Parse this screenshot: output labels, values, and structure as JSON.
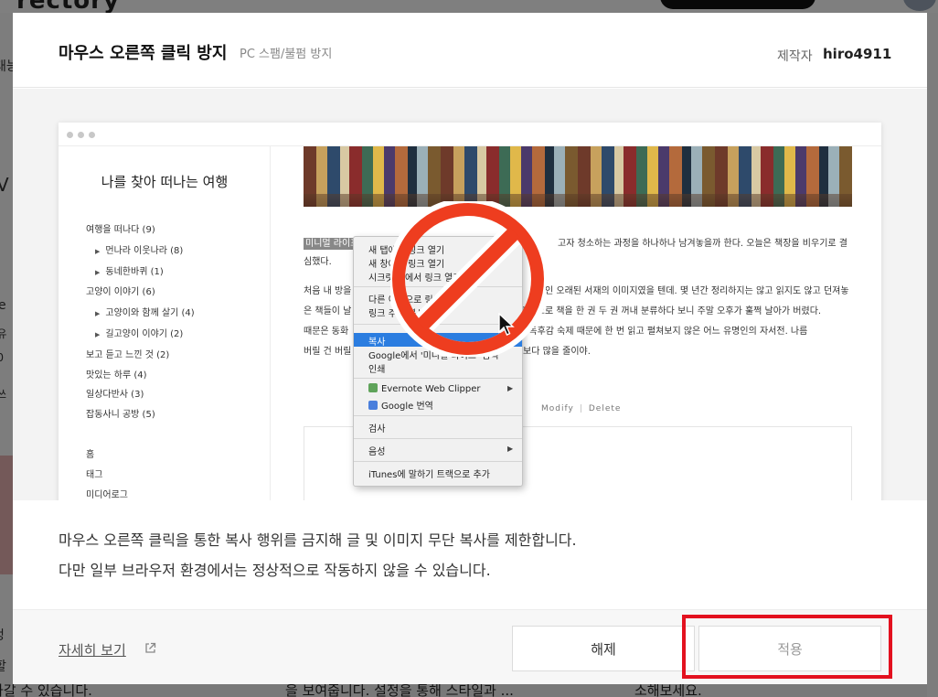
{
  "background": {
    "left_fragments": [
      "태능",
      "V",
      "e",
      "-유",
      "-0",
      "쓰",
      "엉 ",
      "할",
      "가갈 수 있습니다."
    ],
    "bottom_fragments": [
      "을 보여줍니다. 설정을 통해 스타일과 ...",
      "소해보세요."
    ]
  },
  "header": {
    "title": "마우스 오른쪽 클릭 방지",
    "subtitle": "PC 스팸/불펌 방지",
    "author_label": "제작자",
    "author_name": "hiro4911"
  },
  "preview": {
    "blog_title": "나를 찾아 떠나는 여행",
    "categories": [
      {
        "label": "여행을 떠나다 (9)",
        "sub": false
      },
      {
        "label": "먼나라 이웃나라 (8)",
        "sub": true
      },
      {
        "label": "동네한바퀴 (1)",
        "sub": true
      },
      {
        "label": "고양이 이야기 (6)",
        "sub": false
      },
      {
        "label": "고양이와 함께 살기 (4)",
        "sub": true
      },
      {
        "label": "길고양이 이야기 (2)",
        "sub": true
      },
      {
        "label": "보고 듣고 느낀 것 (2)",
        "sub": false
      },
      {
        "label": "맛있는 하루 (4)",
        "sub": false
      },
      {
        "label": "일상다반사 (3)",
        "sub": false
      },
      {
        "label": "잡동사니 공방 (5)",
        "sub": false
      }
    ],
    "nav": [
      "홈",
      "태그",
      "미디어로그"
    ],
    "post": {
      "highlight": "미니멀 라이프",
      "line1": "고자 청소하는 과정을 하나하나 남겨놓을까 한다. 오늘은 책장을 비우기로 결",
      "line2": "심했다.",
      "line3a": "처음 내 방을",
      "line3b": "인 오래된 서재의 이미지였을 텐데. 몇 년간 정리하지는 않고 읽지도 않고 던져놓",
      "line4a": "은 책들이 날",
      "line4b": "는 기준으로 책을 한 권 두 권 꺼내 분류하다 보니 주말 오후가 훌쩍 날아가 버렸다.",
      "line5a": "때문은 동화",
      "line5b": "전 독후감 숙제 때문에 한 번 읽고 펼쳐보지 않은 어느 유명인의 자서전. 나름",
      "line6a": "버릴 건 버릴",
      "line6b": "보다 많을 줄이야.",
      "modify": "Modify",
      "delete": "Delete"
    },
    "context_menu": {
      "items_group1": [
        "새 탭에서 링크 열기",
        "새 창에서 링크 열기",
        "시크릿 창에서 링크 열기"
      ],
      "items_group2": [
        "다른 이름으로 링크 저장",
        "링크 주소 복사"
      ],
      "highlighted": "복사",
      "google_search": "Google에서 '미니멀 라이프' 검색",
      "print": "인쇄",
      "evernote": "Evernote Web Clipper",
      "google_translate": "Google 번역",
      "inspect": "검사",
      "speech": "음성",
      "itunes": "iTunes에 말하기 트랙으로 추가"
    }
  },
  "description": {
    "line1": "마우스 오른쪽 클릭을 통한 복사 행위를 금지해 글 및 이미지 무단 복사를 제한합니다.",
    "line2": "다만 일부 브라우저 환경에서는 정상적으로 작동하지 않을 수 있습니다."
  },
  "footer": {
    "more_link": "자세히 보기",
    "release_button": "해제",
    "apply_button": "적용"
  },
  "colors": {
    "highlight_box": "#e3111f",
    "prohibition_sign": "#ee3d1f",
    "menu_highlight": "#2b7de0"
  },
  "icons": {
    "external_link": "external-link-icon",
    "prohibition": "no-sign-icon",
    "cursor": "mouse-pointer-icon"
  }
}
